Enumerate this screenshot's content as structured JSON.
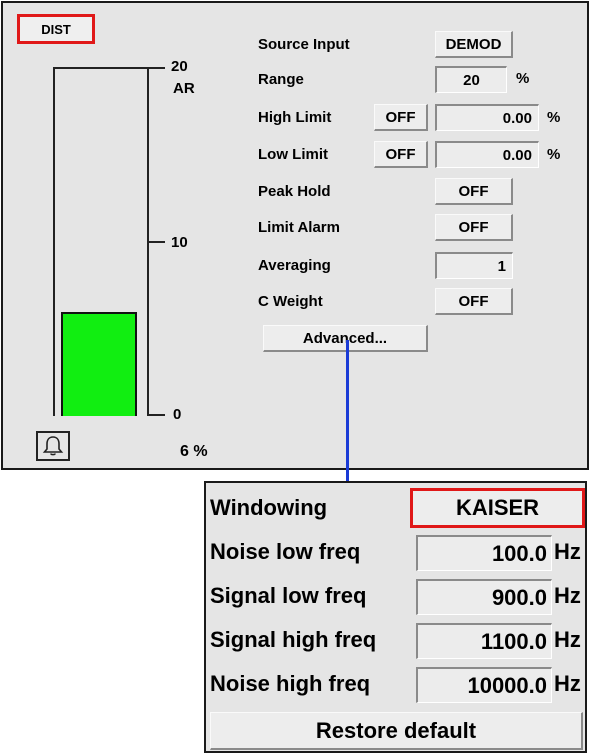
{
  "meter": {
    "tab_label": "DIST",
    "scale_top": "20",
    "scale_unit": "AR",
    "scale_mid": "10",
    "scale_bottom": "0",
    "level_fraction": 0.3,
    "readout": "6 %",
    "bell_icon": "bell-icon",
    "fill_color": "#11ee11"
  },
  "settings": {
    "source_input": {
      "label": "Source Input",
      "value": "DEMOD"
    },
    "range": {
      "label": "Range",
      "value": "20",
      "unit": "%"
    },
    "high_limit": {
      "label": "High Limit",
      "toggle": "OFF",
      "value": "0.00",
      "unit": "%"
    },
    "low_limit": {
      "label": "Low Limit",
      "toggle": "OFF",
      "value": "0.00",
      "unit": "%"
    },
    "peak_hold": {
      "label": "Peak Hold",
      "value": "OFF"
    },
    "limit_alarm": {
      "label": "Limit Alarm",
      "value": "OFF"
    },
    "averaging": {
      "label": "Averaging",
      "value": "1"
    },
    "c_weight": {
      "label": "C Weight",
      "value": "OFF"
    },
    "advanced_label": "Advanced..."
  },
  "advanced": {
    "windowing": {
      "label": "Windowing",
      "value": "KAISER"
    },
    "noise_low": {
      "label": "Noise low freq",
      "value": "100.0",
      "unit": "Hz"
    },
    "signal_low": {
      "label": "Signal low freq",
      "value": "900.0",
      "unit": "Hz"
    },
    "signal_high": {
      "label": "Signal high freq",
      "value": "1100.0",
      "unit": "Hz"
    },
    "noise_high": {
      "label": "Noise high freq",
      "value": "10000.0",
      "unit": "Hz"
    },
    "restore_label": "Restore default"
  },
  "colors": {
    "highlight": "#e01818",
    "connector": "#1a3bd6"
  }
}
